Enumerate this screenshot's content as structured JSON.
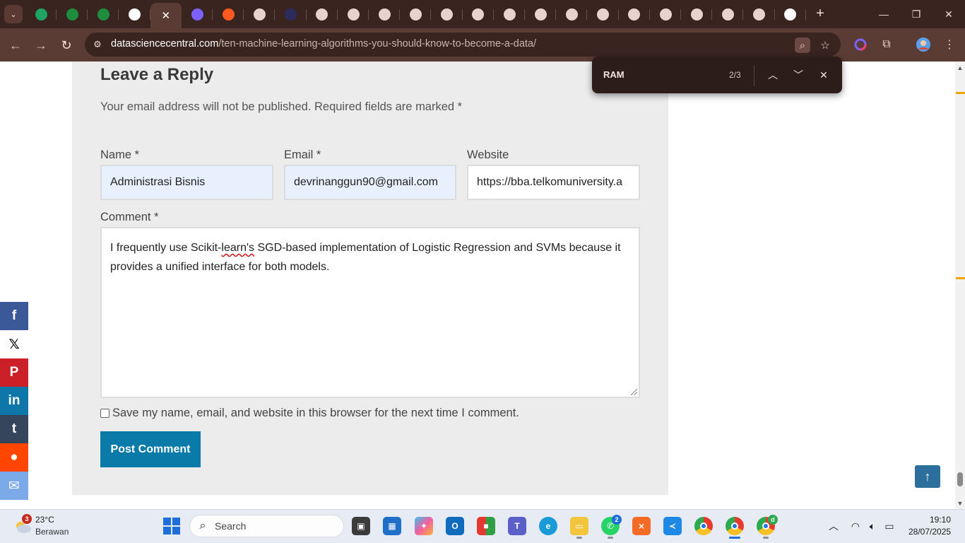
{
  "browser": {
    "tabs": [
      {
        "icon": "google-drive-icon",
        "color": "#1fa463"
      },
      {
        "icon": "sheets-icon",
        "color": "#1e8e3e"
      },
      {
        "icon": "sheets-icon",
        "color": "#1e8e3e"
      },
      {
        "icon": "google-icon",
        "color": "#ffffff"
      },
      {
        "icon": "close-icon",
        "color": "#ffffff",
        "active": true
      },
      {
        "icon": "app-icon",
        "color": "#7b61ff"
      },
      {
        "icon": "app-icon",
        "color": "#ff5a1f"
      },
      {
        "icon": "site-icon",
        "color": "#e7d3cd"
      },
      {
        "icon": "site-icon",
        "color": "#2c2c5c"
      },
      {
        "icon": "site-icon",
        "color": "#e7d3cd"
      },
      {
        "icon": "site-icon",
        "color": "#e7d3cd"
      },
      {
        "icon": "site-icon",
        "color": "#e7d3cd"
      },
      {
        "icon": "site-icon",
        "color": "#e7d3cd"
      },
      {
        "icon": "site-icon",
        "color": "#e7d3cd"
      },
      {
        "icon": "site-icon",
        "color": "#e7d3cd"
      },
      {
        "icon": "site-icon",
        "color": "#e7d3cd"
      },
      {
        "icon": "site-icon",
        "color": "#e7d3cd"
      },
      {
        "icon": "site-icon",
        "color": "#e7d3cd"
      },
      {
        "icon": "site-icon",
        "color": "#e7d3cd"
      },
      {
        "icon": "site-icon",
        "color": "#e7d3cd"
      },
      {
        "icon": "site-icon",
        "color": "#e7d3cd"
      },
      {
        "icon": "site-icon",
        "color": "#e7d3cd"
      },
      {
        "icon": "site-icon",
        "color": "#e7d3cd"
      },
      {
        "icon": "site-icon",
        "color": "#e7d3cd"
      },
      {
        "icon": "google-icon",
        "color": "#ffffff"
      }
    ],
    "url_host": "datasciencecentral.com",
    "url_path": "/ten-machine-learning-algorithms-you-should-know-to-become-a-data/"
  },
  "find": {
    "query": "RAM",
    "count": "2/3"
  },
  "reply": {
    "title": "Leave a Reply",
    "note": "Your email address will not be published. Required fields are marked *",
    "name_label": "Name *",
    "name_value": "Administrasi Bisnis",
    "email_label": "Email *",
    "email_value": "devrinanggun90@gmail.com",
    "website_label": "Website",
    "website_value": "https://bba.telkomuniversity.a",
    "comment_label": "Comment *",
    "comment_part1": "I frequently use Scikit-",
    "comment_misspelled": "learn's",
    "comment_part2": " SGD-based implementation of Logistic Regression and SVMs because it provides a unified interface for both models.",
    "remember_label": "Save my name, email, and website in this browser for the next time I comment.",
    "submit_label": "Post Comment"
  },
  "share": [
    {
      "name": "facebook",
      "glyph": "f",
      "color": "#3b5998"
    },
    {
      "name": "x",
      "glyph": "𝕏",
      "color": "#ffffff"
    },
    {
      "name": "pinterest",
      "glyph": "P",
      "color": "#cb2027"
    },
    {
      "name": "linkedin",
      "glyph": "in",
      "color": "#0e76a8"
    },
    {
      "name": "tumblr",
      "glyph": "t",
      "color": "#35465c"
    },
    {
      "name": "reddit",
      "glyph": "●",
      "color": "#ff4500"
    },
    {
      "name": "email",
      "glyph": "✉",
      "color": "#7ca9e8"
    }
  ],
  "taskbar": {
    "weather_badge": "3",
    "temperature": "23°C",
    "weather_desc": "Berawan",
    "search_placeholder": "Search",
    "whatsapp_badge": "2",
    "chrome_profile_badge": "d",
    "time": "19:10",
    "date": "28/07/2025"
  }
}
